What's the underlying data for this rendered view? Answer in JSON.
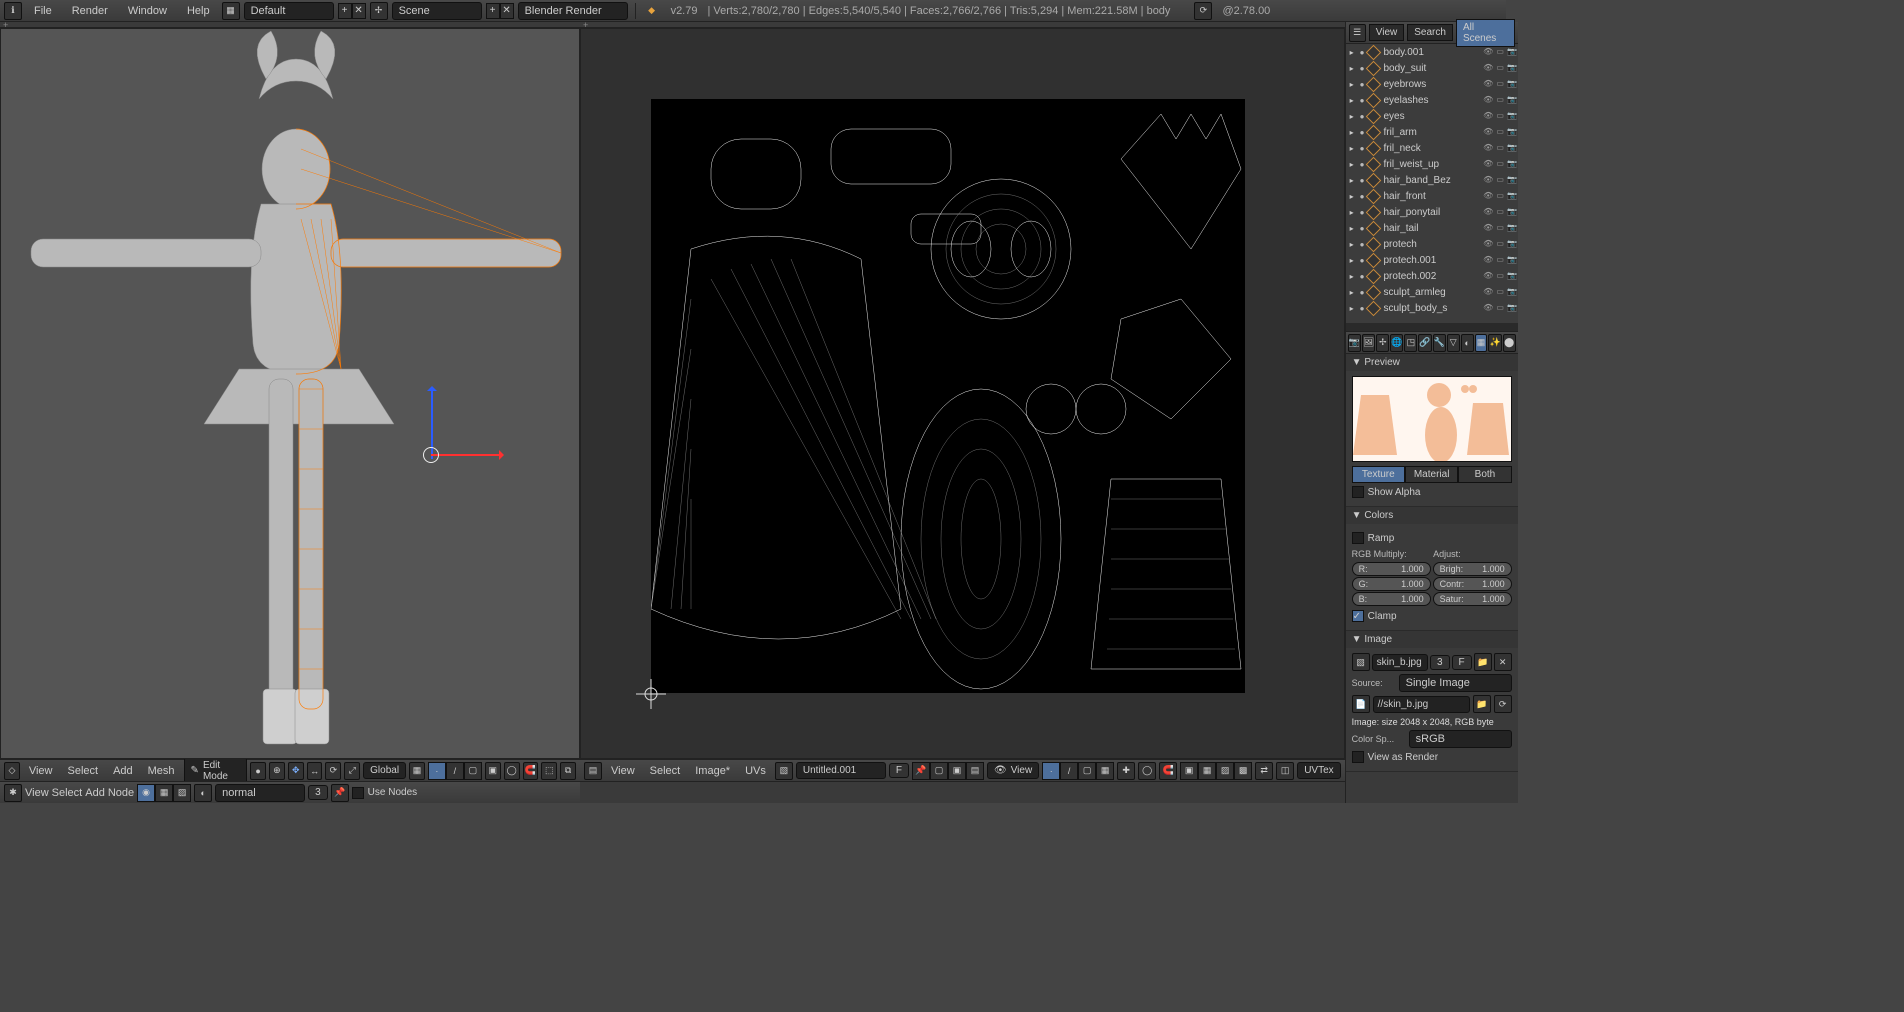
{
  "top_menu": [
    "File",
    "Render",
    "Window",
    "Help"
  ],
  "layout_dd": "Default",
  "scene_dd": "Scene",
  "engine_dd": "Blender Render",
  "version": "v2.79",
  "stats": "Verts:2,780/2,780 | Edges:5,540/5,540 | Faces:2,766/2,766 | Tris:5,294 | Mem:221.58M | body",
  "title_badge": "@2.78.00",
  "outliner_tabs": [
    "View",
    "Search"
  ],
  "outliner_filter": "All Scenes",
  "outliner_items": [
    "body.001",
    "body_suit",
    "eyebrows",
    "eyelashes",
    "eyes",
    "fril_arm",
    "fril_neck",
    "fril_weist_up",
    "hair_band_Bez",
    "hair_front",
    "hair_ponytail",
    "hair_tail",
    "protech",
    "protech.001",
    "protech.002",
    "sculpt_armleg",
    "sculpt_body_s"
  ],
  "view3d_menu": [
    "View",
    "Select",
    "Add",
    "Mesh"
  ],
  "view3d_mode": "Edit Mode",
  "view3d_orientation": "Global",
  "node_menu": [
    "View",
    "Select",
    "Add",
    "Node"
  ],
  "node_mat": "normal",
  "node_usenodes": "Use Nodes",
  "uv_menu": [
    "View",
    "Select",
    "Image*",
    "UVs"
  ],
  "uv_image": "Untitled.001",
  "uv_viewbtn": "View",
  "uv_tex": "UVTex",
  "props_preview": "Preview",
  "props_tabs": [
    "Texture",
    "Material",
    "Both"
  ],
  "props_showalpha": "Show Alpha",
  "props_colors": "Colors",
  "props_ramp": "Ramp",
  "props_rgbmult": "RGB Multiply:",
  "props_adjust": "Adjust:",
  "rgb_r": {
    "k": "R:",
    "v": "1.000"
  },
  "rgb_g": {
    "k": "G:",
    "v": "1.000"
  },
  "rgb_b": {
    "k": "B:",
    "v": "1.000"
  },
  "adj_b": {
    "k": "Brigh:",
    "v": "1.000"
  },
  "adj_c": {
    "k": "Contr:",
    "v": "1.000"
  },
  "adj_s": {
    "k": "Satur:",
    "v": "1.000"
  },
  "props_clamp": "Clamp",
  "props_image": "Image",
  "image_name": "skin_b.jpg",
  "image_src_lbl": "Source:",
  "image_src": "Single Image",
  "image_path": "//skin_b.jpg",
  "image_info": "Image: size 2048 x 2048, RGB byte",
  "colorspace_lbl": "Color Sp...",
  "colorspace": "sRGB",
  "view_as_render": "View as Render",
  "fields_f": "F",
  "fields_3": "3"
}
